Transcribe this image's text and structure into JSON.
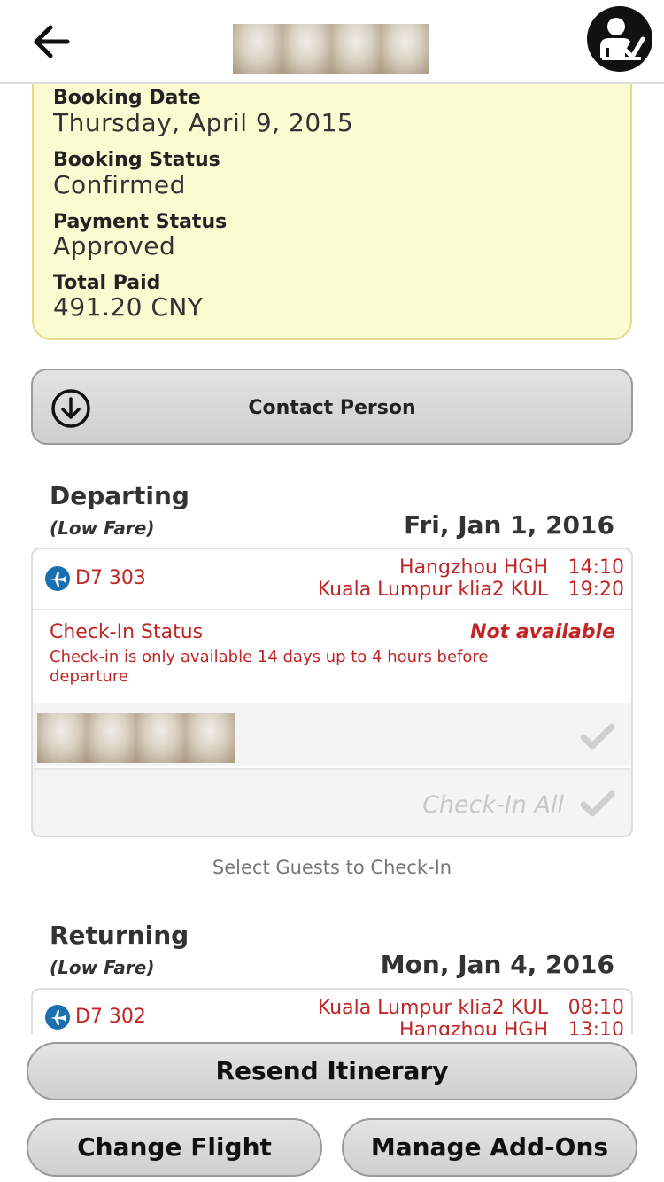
{
  "summary": {
    "booking_date_label": "Booking Date",
    "booking_date": "Thursday, April 9, 2015",
    "booking_status_label": "Booking Status",
    "booking_status": "Confirmed",
    "payment_status_label": "Payment Status",
    "payment_status": "Approved",
    "total_paid_label": "Total Paid",
    "total_paid": "491.20 CNY"
  },
  "contact": {
    "label": "Contact Person"
  },
  "departing": {
    "title": "Departing",
    "fare": "(Low Fare)",
    "date": "Fri, Jan 1, 2016",
    "flight_number": "D7 303",
    "origin": "Hangzhou  HGH",
    "destination": "Kuala Lumpur klia2  KUL",
    "depart_time": "14:10",
    "arrive_time": "19:20",
    "checkin_status_label": "Check-In Status",
    "checkin_status_value": "Not available",
    "checkin_note": "Check-in is only available 14 days up to 4 hours before departure",
    "checkin_all": "Check-In All"
  },
  "select_guests": "Select Guests to Check-In",
  "returning": {
    "title": "Returning",
    "fare": "(Low Fare)",
    "date": "Mon, Jan 4, 2016",
    "flight_number": "D7 302",
    "origin": "Kuala Lumpur klia2  KUL",
    "destination": "Hangzhou  HGH",
    "depart_time": "08:10",
    "arrive_time": "13:10"
  },
  "buttons": {
    "resend": "Resend Itinerary",
    "change_flight": "Change Flight",
    "manage_addons": "Manage Add-Ons"
  },
  "colors": {
    "accent_red": "#c22525",
    "summary_bg": "#fbfbd1",
    "flight_icon": "#1a6fae"
  }
}
